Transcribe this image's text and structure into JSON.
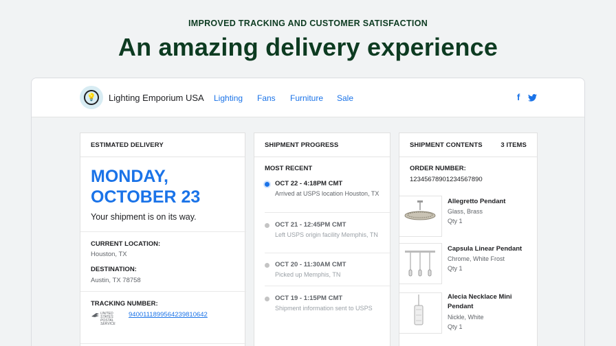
{
  "hero": {
    "eyebrow": "IMPROVED TRACKING AND CUSTOMER SATISFACTION",
    "title": "An amazing delivery experience"
  },
  "header": {
    "brand": "Lighting Emporium USA",
    "logo_icon": "lightbulb-icon",
    "nav": [
      "Lighting",
      "Fans",
      "Furniture",
      "Sale"
    ],
    "social": [
      {
        "icon": "facebook-icon",
        "glyph": "f"
      },
      {
        "icon": "twitter-icon",
        "glyph": "🐦"
      }
    ]
  },
  "estimated": {
    "heading": "ESTIMATED DELIVERY",
    "date_line1": "MONDAY,",
    "date_line2": "OCTOBER 23",
    "status": "Your shipment is on its way.",
    "current_label": "CURRENT LOCATION:",
    "current_value": "Houston, TX",
    "dest_label": "DESTINATION:",
    "dest_value": "Austin, TX 78758",
    "tracking_label": "TRACKING NUMBER:",
    "carrier_logo_text": "UNITED STATES POSTAL SERVICE",
    "tracking_number": "9400111899564239810642"
  },
  "progress": {
    "heading": "SHIPMENT PROGRESS",
    "most_recent_label": "MOST RECENT",
    "steps": [
      {
        "title": "OCT 22 - 4:18PM CMT",
        "desc": "Arrived at USPS location Houston, TX",
        "active": true
      },
      {
        "title": "OCT 21 - 12:45PM CMT",
        "desc": "Left USPS origin facility Memphis, TN",
        "active": false
      },
      {
        "title": "OCT 20 - 11:30AM CMT",
        "desc": "Picked up Memphis, TN",
        "active": false
      },
      {
        "title": "OCT 19 - 1:15PM CMT",
        "desc": "Shipment information sent to USPS",
        "active": false
      }
    ]
  },
  "contents": {
    "heading": "SHIPMENT CONTENTS",
    "count": "3 ITEMS",
    "order_label": "ORDER NUMBER:",
    "order_number": "12345678901234567890",
    "items": [
      {
        "name": "Allegretto Pendant",
        "material": "Glass, Brass",
        "qty": "Qty 1"
      },
      {
        "name": "Capsula Linear Pendant",
        "material": "Chrome, White Frost",
        "qty": "Qty 1"
      },
      {
        "name": "Alecia Necklace Mini Pendant",
        "material": "Nickle, White",
        "qty": "Qty 1"
      }
    ]
  },
  "colors": {
    "accent": "#1a73e8",
    "hero_text": "#0d3b21",
    "background": "#f1f3f4"
  }
}
